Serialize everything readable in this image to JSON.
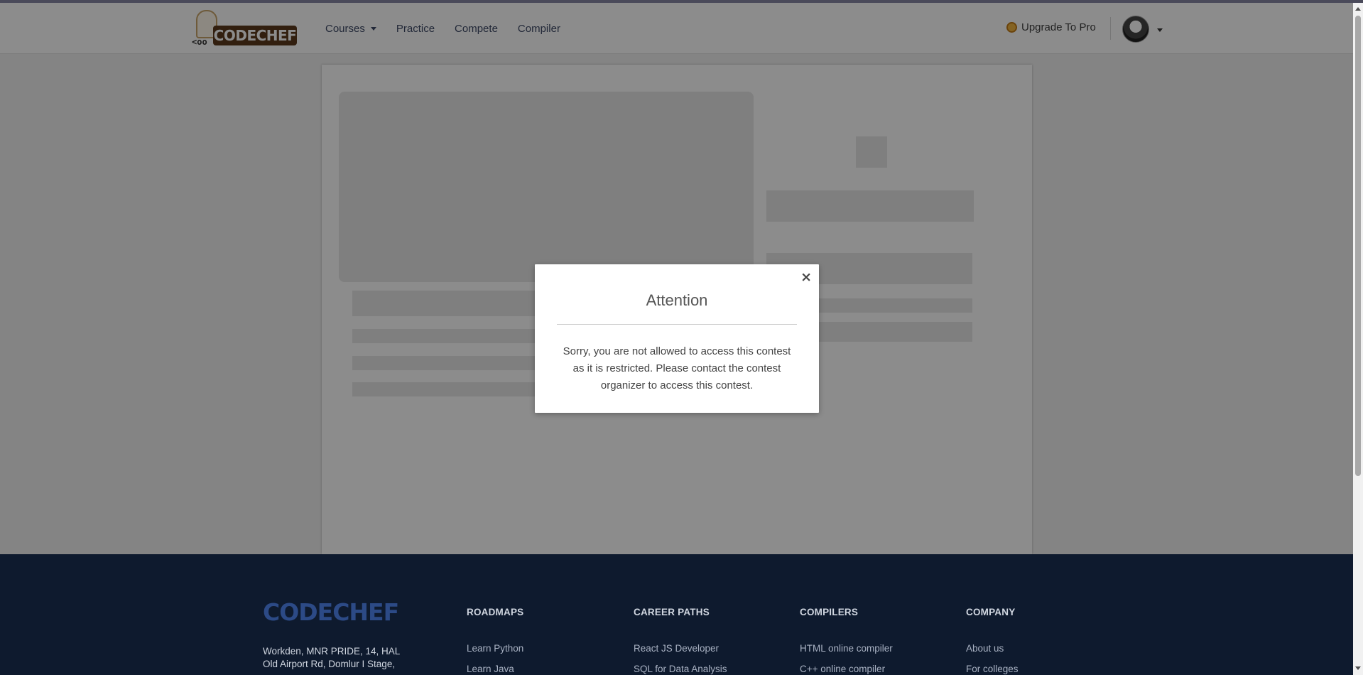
{
  "header": {
    "logo_text": "CODECHEF",
    "nav": [
      {
        "label": "Courses",
        "has_dropdown": true
      },
      {
        "label": "Practice",
        "has_dropdown": false
      },
      {
        "label": "Compete",
        "has_dropdown": false
      },
      {
        "label": "Compiler",
        "has_dropdown": false
      }
    ],
    "upgrade_label": "Upgrade To Pro"
  },
  "modal": {
    "title": "Attention",
    "close_symbol": "×",
    "message": "Sorry, you are not allowed to access this contest as it is restricted. Please contact the contest organizer to access this contest."
  },
  "footer": {
    "logo_text": "CODECHEF",
    "address": "Workden, MNR PRIDE, 14, HAL Old Airport Rd, Domlur I Stage,",
    "columns": [
      {
        "heading": "ROADMAPS",
        "links": [
          "Learn Python",
          "Learn Java"
        ]
      },
      {
        "heading": "CAREER PATHS",
        "links": [
          "React JS Developer",
          "SQL for Data Analysis"
        ]
      },
      {
        "heading": "COMPILERS",
        "links": [
          "HTML online compiler",
          "C++ online compiler"
        ]
      },
      {
        "heading": "COMPANY",
        "links": [
          "About us",
          "For colleges"
        ]
      }
    ]
  },
  "colors": {
    "footer_bg": "#0e1a2e",
    "nav_text": "#3e4a66",
    "pro_coin": "#f0b440"
  },
  "icons": {
    "close": "close-icon",
    "pro": "coin-icon",
    "dropdown": "chevron-down-icon"
  }
}
